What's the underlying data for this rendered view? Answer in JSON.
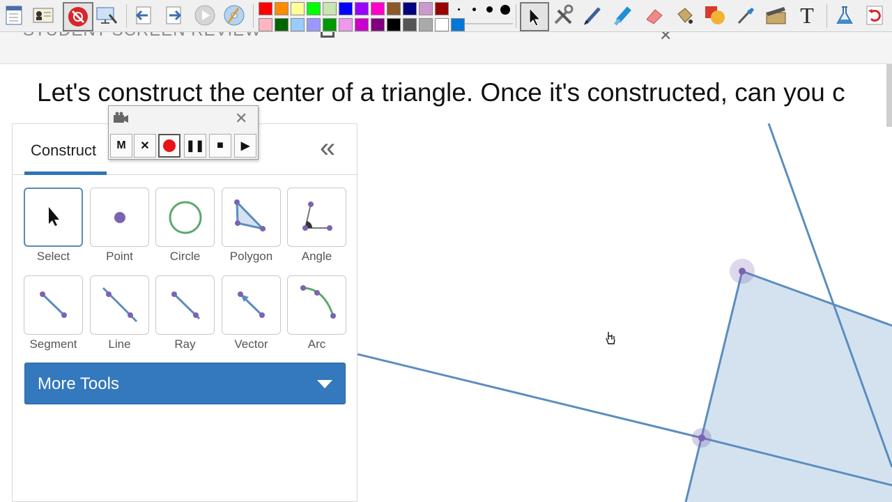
{
  "page_header": {
    "title": "STUDENT SCREEN REVIEW"
  },
  "question": {
    "text": "Let's construct the center of a triangle. Once it's constructed, can you c"
  },
  "toolbar": {
    "palette_top": [
      "#ff0000",
      "#ff8c00",
      "#ffff99",
      "#00ff00",
      "#c8e6b0",
      "#0000ff",
      "#9900ff",
      "#ff00cc",
      "#8b5a2b",
      "#000080",
      "#cc99cc",
      "#990000"
    ],
    "palette_bottom": [
      "#ffb6c1",
      "#006400",
      "#99ccff",
      "#9999ff",
      "#009900",
      "#ee99ee",
      "#cc00cc",
      "#800080",
      "#000000",
      "#555555",
      "#aaaaaa",
      "#ffffff",
      "#0078d7"
    ],
    "icons": [
      "menu-icon",
      "id-card-icon",
      "no-annotate-icon",
      "monitor-settings-icon",
      "back-arrow-icon",
      "forward-arrow-icon",
      "play-icon",
      "disc-icon",
      "cursor-icon",
      "tools-icon",
      "pen-icon",
      "highlighter-icon",
      "eraser-icon",
      "fill-bucket-icon",
      "shapes-icon",
      "eyedropper-icon",
      "clapper-icon",
      "text-icon",
      "flask-icon",
      "refresh-icon"
    ],
    "text_tool_label": "T"
  },
  "recorder": {
    "buttons": [
      {
        "name": "rec-mode-button",
        "label": "M"
      },
      {
        "name": "rec-cancel-button",
        "label": "✕"
      },
      {
        "name": "rec-record-button",
        "label": ""
      },
      {
        "name": "rec-pause-button",
        "label": "❚❚"
      },
      {
        "name": "rec-stop-button",
        "label": "■"
      },
      {
        "name": "rec-play-button",
        "label": "▶"
      }
    ]
  },
  "tool_panel": {
    "tab_label": "Construct",
    "collapse_label": "«",
    "tools": [
      {
        "name": "select",
        "label": "Select"
      },
      {
        "name": "point",
        "label": "Point"
      },
      {
        "name": "circle",
        "label": "Circle"
      },
      {
        "name": "polygon",
        "label": "Polygon"
      },
      {
        "name": "angle",
        "label": "Angle"
      },
      {
        "name": "segment",
        "label": "Segment"
      },
      {
        "name": "line",
        "label": "Line"
      },
      {
        "name": "ray",
        "label": "Ray"
      },
      {
        "name": "vector",
        "label": "Vector"
      },
      {
        "name": "arc",
        "label": "Arc"
      }
    ],
    "more_tools_label": "More Tools"
  },
  "colors": {
    "accent": "#3478bd",
    "shape_fill": "#d4e2f0",
    "shape_stroke": "#5b8dbf",
    "point": "#7d62b3"
  }
}
